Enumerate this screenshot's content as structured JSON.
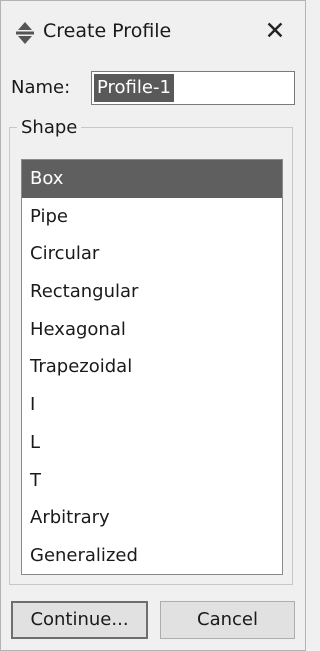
{
  "window": {
    "title": "Create Profile",
    "icon": "move-arrows-icon",
    "close_symbol": "✕"
  },
  "name_field": {
    "label": "Name:",
    "value": "Profile-1"
  },
  "shape_group": {
    "legend": "Shape",
    "items": [
      {
        "label": "Box",
        "selected": true
      },
      {
        "label": "Pipe"
      },
      {
        "label": "Circular"
      },
      {
        "label": "Rectangular"
      },
      {
        "label": "Hexagonal"
      },
      {
        "label": "Trapezoidal"
      },
      {
        "label": "I"
      },
      {
        "label": "L"
      },
      {
        "label": "T"
      },
      {
        "label": "Arbitrary"
      },
      {
        "label": "Generalized"
      }
    ]
  },
  "buttons": {
    "continue": "Continue...",
    "cancel": "Cancel"
  }
}
